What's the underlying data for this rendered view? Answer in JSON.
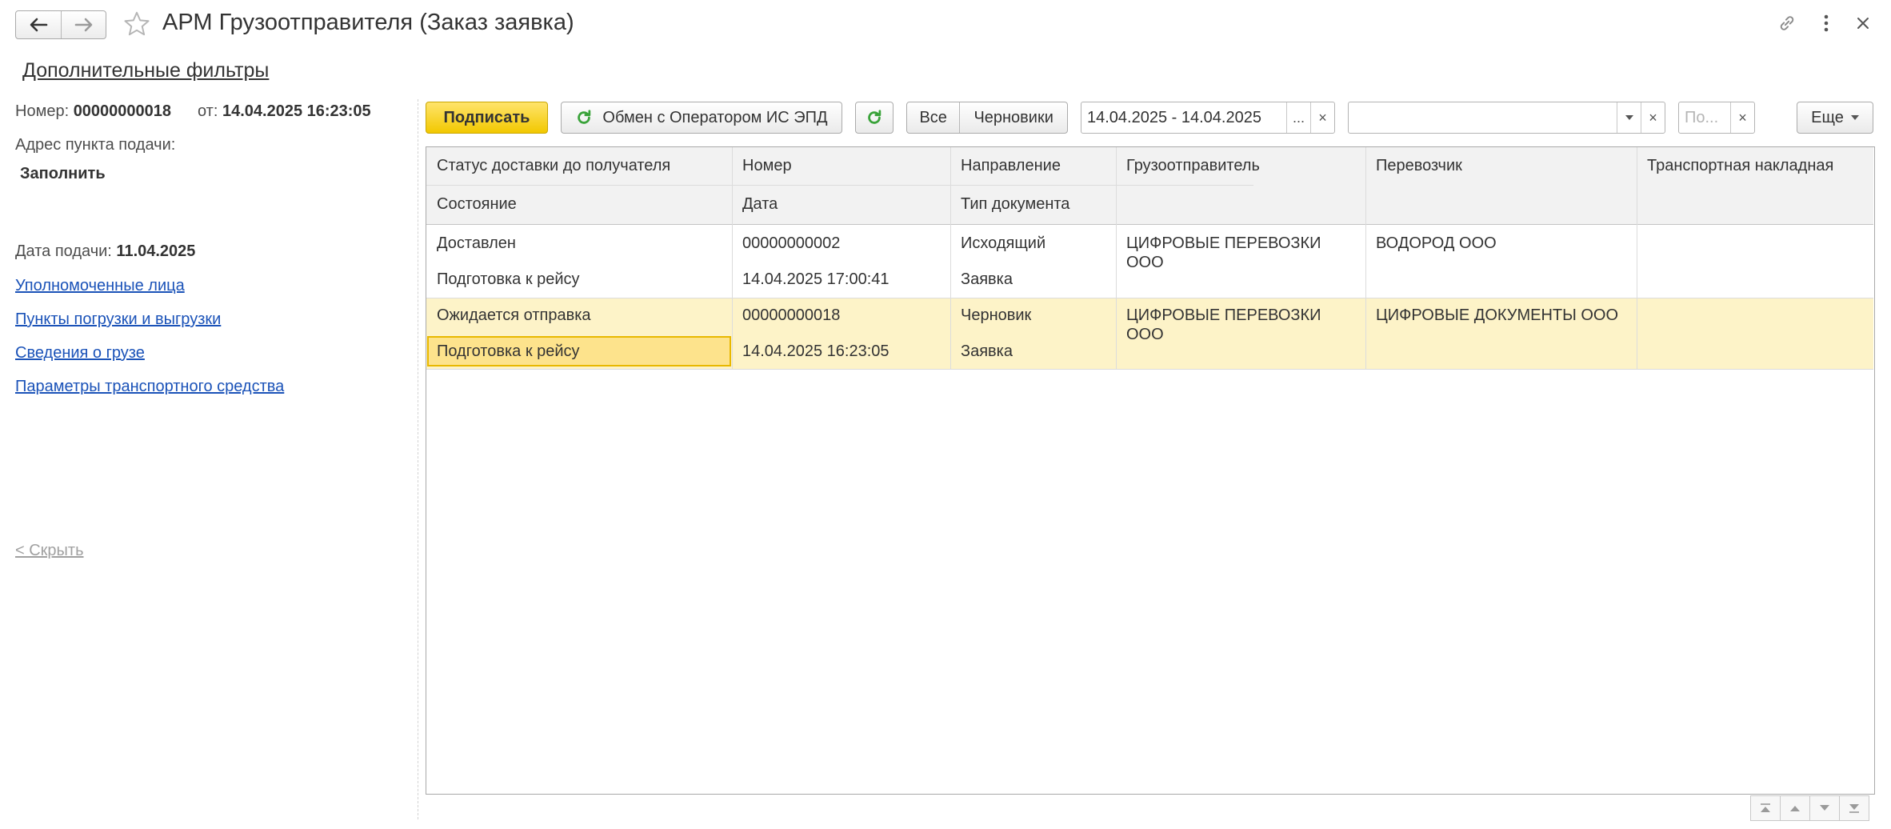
{
  "window": {
    "title": "АРМ Грузоотправителя (Заказ заявка)"
  },
  "filters_link": "Дополнительные фильтры",
  "left_panel": {
    "number_label": "Номер:",
    "number_value": "00000000018",
    "from_label": "от:",
    "from_value": "14.04.2025 16:23:05",
    "address_label": "Адрес пункта подачи:",
    "address_value": "Заполнить",
    "date_label": "Дата подачи:",
    "date_value": "11.04.2025",
    "links": [
      "Уполномоченные лица",
      "Пункты погрузки и выгрузки",
      "Сведения о грузе",
      "Параметры транспортного средства"
    ],
    "hide_label": "< Скрыть"
  },
  "toolbar": {
    "sign_label": "Подписать",
    "exchange_label": "Обмен с Оператором ИС ЭПД",
    "filter_all": "Все",
    "filter_drafts": "Черновики",
    "period_value": "14.04.2025 - 14.04.2025",
    "period_more": "...",
    "clear_symbol": "×",
    "org_value": "",
    "search_placeholder": "По...",
    "more_label": "Еще"
  },
  "table": {
    "headers": {
      "status_delivery": "Статус доставки до получателя",
      "state": "Состояние",
      "number": "Номер",
      "date": "Дата",
      "direction": "Направление",
      "doc_type": "Тип документа",
      "shipper": "Грузоотправитель",
      "carrier": "Перевозчик",
      "waybill": "Транспортная накладная"
    },
    "rows": [
      {
        "status_delivery": "Доставлен",
        "state": "Подготовка к рейсу",
        "number": "00000000002",
        "date": "14.04.2025 17:00:41",
        "direction": "Исходящий",
        "doc_type": "Заявка",
        "shipper_line1": "ЦИФРОВЫЕ ПЕРЕВОЗКИ",
        "shipper_line2": "ООО",
        "carrier": "ВОДОРОД ООО",
        "waybill": ""
      },
      {
        "status_delivery": "Ожидается отправка",
        "state": "Подготовка к рейсу",
        "number": "00000000018",
        "date": "14.04.2025 16:23:05",
        "direction": "Черновик",
        "doc_type": "Заявка",
        "shipper_line1": "ЦИФРОВЫЕ ПЕРЕВОЗКИ",
        "shipper_line2": "ООО",
        "carrier": "ЦИФРОВЫЕ ДОКУМЕНТЫ ООО",
        "waybill": ""
      }
    ]
  },
  "colors": {
    "accent_yellow": "#f2c800",
    "selected_row": "#fdf3c8",
    "selected_cell": "#fde38c",
    "link_blue": "#1a52b8",
    "refresh_green": "#3aa33a"
  },
  "icons": {
    "back": "arrow-left-icon",
    "forward": "arrow-right-icon",
    "favorite": "star-icon",
    "link": "link-icon",
    "menu": "more-vertical-icon",
    "close": "close-icon",
    "refresh": "refresh-icon"
  }
}
